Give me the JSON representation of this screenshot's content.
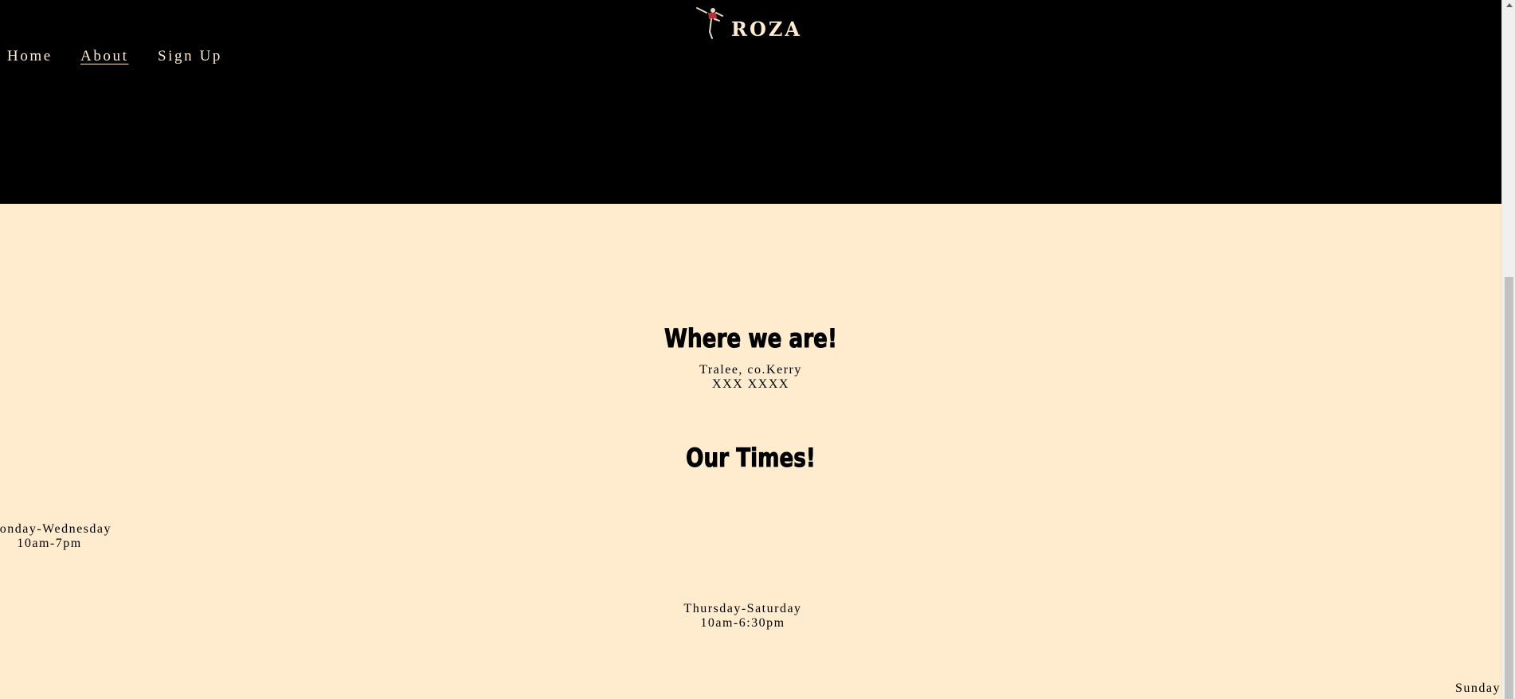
{
  "brand": {
    "name": "ROZA",
    "logo_icon": "kicking-figure-icon"
  },
  "nav": {
    "items": [
      {
        "label": "Home"
      },
      {
        "label": "About"
      },
      {
        "label": "Sign Up"
      }
    ],
    "active": "About"
  },
  "location": {
    "heading": "Where we are!",
    "lines": [
      "Tralee, co.Kerry",
      "XXX XXXX"
    ]
  },
  "times": {
    "heading": "Our Times!",
    "slots": [
      {
        "days": "Monday-Wednesday",
        "hours": "10am-7pm"
      },
      {
        "days": "Thursday-Saturday",
        "hours": "10am-6:30pm"
      },
      {
        "days": "Sunday",
        "hours": ""
      }
    ]
  },
  "colors": {
    "header_bg": "#000000",
    "page_bg": "#ffeccf",
    "nav_text": "#ffeccf",
    "heading_text": "#000000"
  }
}
